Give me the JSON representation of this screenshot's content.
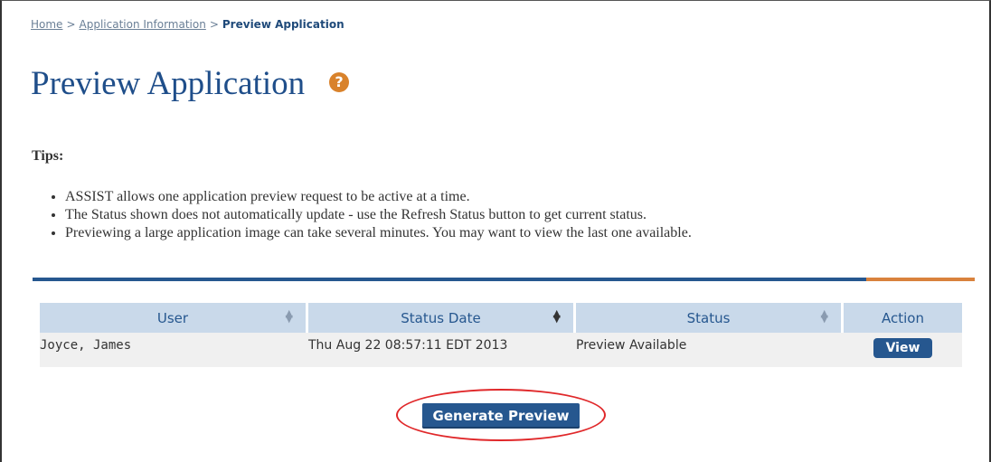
{
  "breadcrumb": {
    "items": [
      "Home",
      "Application Information"
    ],
    "separator": ">",
    "current": "Preview Application"
  },
  "page": {
    "title": "Preview Application",
    "help_icon": "question-circle-icon",
    "help_glyph": "?"
  },
  "tips": {
    "heading": "Tips:",
    "items": [
      "ASSIST allows one application preview request to be active at a time.",
      "The Status shown does not automatically update - use the Refresh Status button to get current status.",
      "Previewing a large application image can take several minutes.  You may want to view the last one available."
    ]
  },
  "table": {
    "columns": [
      "User",
      "Status Date",
      "Status",
      "Action"
    ],
    "rows": [
      {
        "user": "Joyce, James",
        "status_date": "Thu Aug 22 08:57:11 EDT 2013",
        "status": "Preview Available",
        "action": "View"
      }
    ]
  },
  "generate_button": "Generate Preview",
  "colors": {
    "brand_blue": "#26578f",
    "accent_orange": "#d9822b",
    "highlight_red": "#e0282a",
    "header_bg": "#c9d9ea"
  }
}
